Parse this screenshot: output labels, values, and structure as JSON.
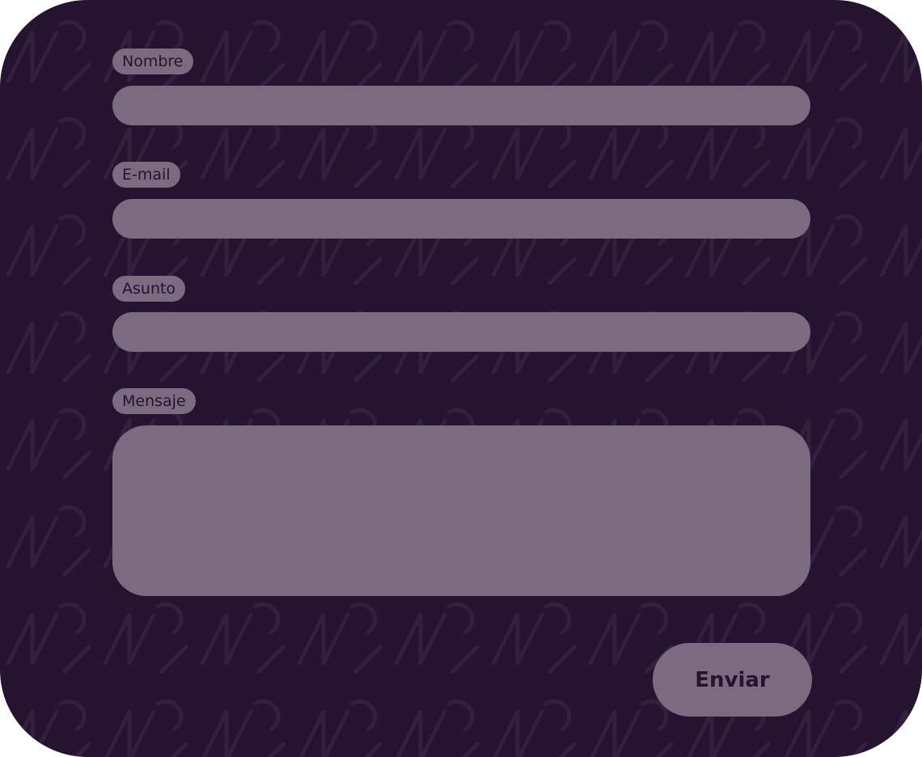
{
  "form": {
    "fields": [
      {
        "label": "Nombre",
        "value": ""
      },
      {
        "label": "E-mail",
        "value": ""
      },
      {
        "label": "Asunto",
        "value": ""
      },
      {
        "label": "Mensaje",
        "value": ""
      }
    ],
    "submit_label": "Enviar"
  },
  "colors": {
    "background": "#251330",
    "field": "#7b6a80",
    "text": "#251330"
  }
}
